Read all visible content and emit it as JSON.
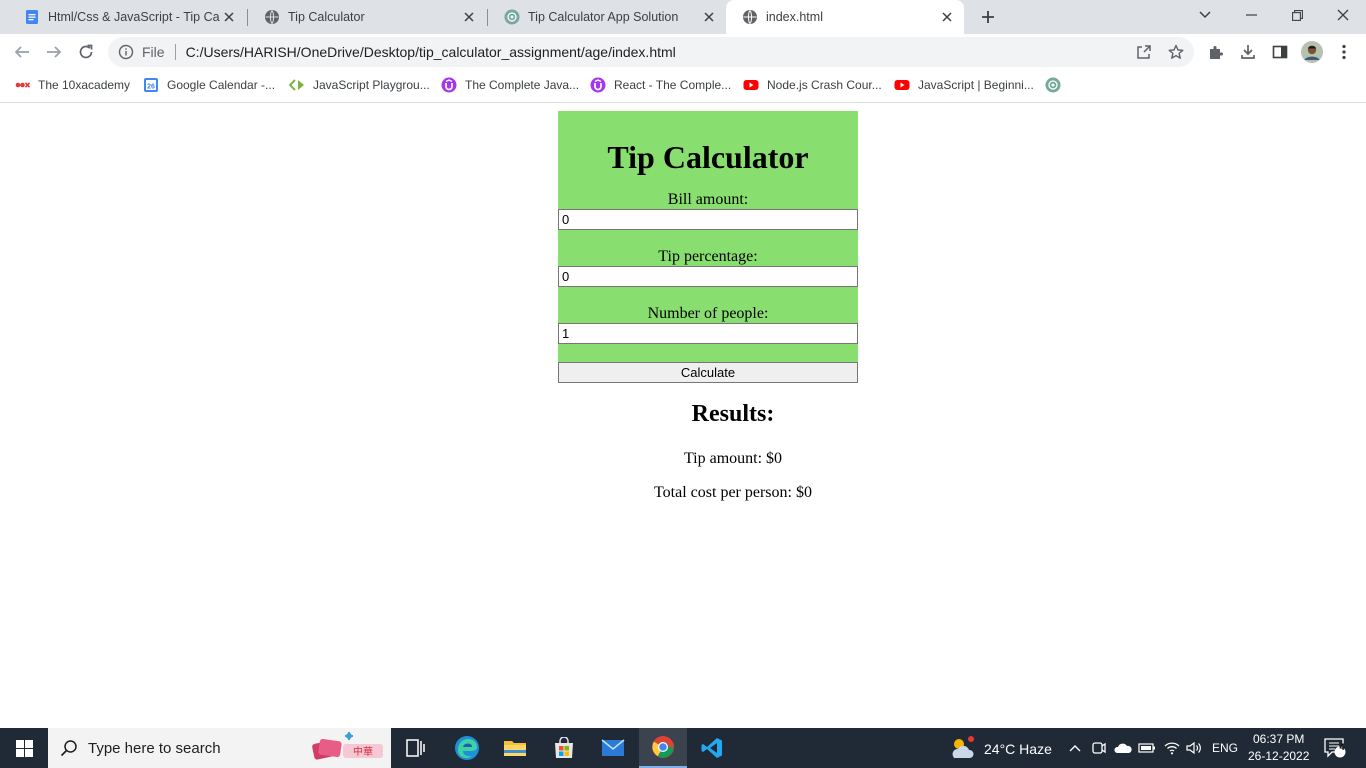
{
  "browser": {
    "tabs": [
      {
        "title": "Html/Css & JavaScript - Tip Calcu",
        "icon": "docs-icon",
        "active": false
      },
      {
        "title": "Tip Calculator",
        "icon": "globe-icon",
        "active": false
      },
      {
        "title": "Tip Calculator App Solution",
        "icon": "openai-icon",
        "active": false
      },
      {
        "title": "index.html",
        "icon": "globe-icon",
        "active": true
      }
    ],
    "address": {
      "scheme": "File",
      "url": "C:/Users/HARISH/OneDrive/Desktop/tip_calculator_assignment/age/index.html"
    },
    "bookmarks": [
      {
        "label": "The 10xacademy",
        "icon": "10x-icon"
      },
      {
        "label": "Google Calendar -...",
        "icon": "calendar-icon"
      },
      {
        "label": "JavaScript Playgrou...",
        "icon": "playground-icon"
      },
      {
        "label": "The Complete Java...",
        "icon": "udemy-icon"
      },
      {
        "label": "React - The Comple...",
        "icon": "udemy-icon"
      },
      {
        "label": "Node.js Crash Cour...",
        "icon": "youtube-icon"
      },
      {
        "label": "JavaScript | Beginni...",
        "icon": "youtube-icon"
      }
    ]
  },
  "page": {
    "title": "Tip Calculator",
    "bill_label": "Bill amount:",
    "bill_value": "0",
    "tip_label": "Tip percentage:",
    "tip_value": "0",
    "people_label": "Number of people:",
    "people_value": "1",
    "button_label": "Calculate",
    "results_heading": "Results:",
    "tip_amount": "Tip amount: $0",
    "total_per_person": "Total cost per person: $0",
    "colors": {
      "card": "#88df70"
    }
  },
  "taskbar": {
    "search_placeholder": "Type here to search",
    "weather": "24°C  Haze",
    "language": "ENG",
    "time": "06:37 PM",
    "date": "26-12-2022",
    "notifications": "4"
  }
}
